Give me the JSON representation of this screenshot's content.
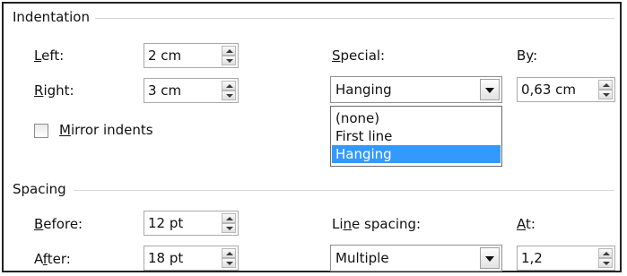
{
  "indentation": {
    "section_title": "Indentation",
    "left": {
      "label": "Left:",
      "accel": "L",
      "rest": "eft:",
      "value": "2 cm"
    },
    "right": {
      "label": "Right:",
      "accel": "R",
      "rest": "ight:",
      "value": "3 cm"
    },
    "special": {
      "label": "Special:",
      "accel": "S",
      "rest": "pecial:",
      "value": "Hanging",
      "options": [
        "(none)",
        "First line",
        "Hanging"
      ],
      "selected_index": 2
    },
    "by": {
      "label": "By:",
      "pre": "B",
      "accel": "y",
      "rest": ":",
      "value": "0,63 cm"
    },
    "mirror": {
      "label": "Mirror indents",
      "accel": "M",
      "rest": "irror indents",
      "checked": false
    }
  },
  "spacing": {
    "section_title": "Spacing",
    "before": {
      "label": "Before:",
      "accel": "B",
      "rest": "efore:",
      "value": "12 pt"
    },
    "after": {
      "label": "After:",
      "pre": "A",
      "accel": "f",
      "rest": "ter:",
      "value": "18 pt"
    },
    "line_spacing": {
      "label": "Line spacing:",
      "pre": "Li",
      "accel": "n",
      "rest": "e spacing:",
      "value": "Multiple"
    },
    "at": {
      "label": "At:",
      "accel": "A",
      "rest": "t:",
      "value": "1,2"
    }
  },
  "colors": {
    "selection": "#3399ff",
    "border": "#222222",
    "rule": "#d7d7d7"
  }
}
